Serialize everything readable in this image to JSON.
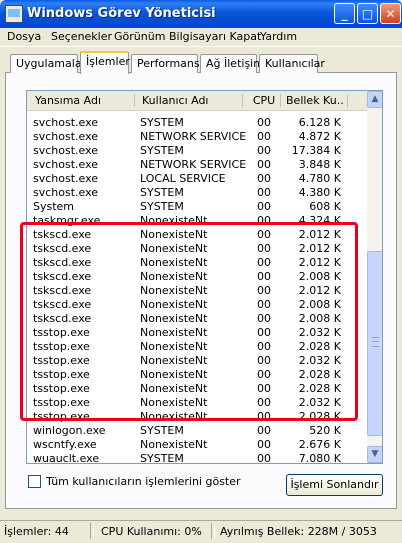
{
  "window": {
    "title": "Windows Görev Yöneticisi"
  },
  "menu": [
    "Dosya",
    "Seçenekler",
    "Görünüm",
    "Bilgisayarı Kapat",
    "Yardım"
  ],
  "tabs": [
    "Uygulamalar",
    "İşlemler",
    "Performans",
    "Ağ İletişimi",
    "Kullanıcılar"
  ],
  "active_tab": "İşlemler",
  "columns": [
    "Yansıma Adı",
    "Kullanıcı Adı",
    "CPU",
    "Bellek Ku..."
  ],
  "processes": [
    [
      "svchost.exe",
      "SYSTEM",
      "00",
      "6.128 K"
    ],
    [
      "svchost.exe",
      "NETWORK SERVICE",
      "00",
      "4.872 K"
    ],
    [
      "svchost.exe",
      "SYSTEM",
      "00",
      "17.384 K"
    ],
    [
      "svchost.exe",
      "NETWORK SERVICE",
      "00",
      "3.848 K"
    ],
    [
      "svchost.exe",
      "LOCAL SERVICE",
      "00",
      "4.780 K"
    ],
    [
      "svchost.exe",
      "SYSTEM",
      "00",
      "4.380 K"
    ],
    [
      "System",
      "SYSTEM",
      "00",
      "608 K"
    ],
    [
      "taskmgr.exe",
      "NonexisteNt",
      "00",
      "4.324 K"
    ],
    [
      "tskscd.exe",
      "NonexisteNt",
      "00",
      "2.012 K"
    ],
    [
      "tskscd.exe",
      "NonexisteNt",
      "00",
      "2.012 K"
    ],
    [
      "tskscd.exe",
      "NonexisteNt",
      "00",
      "2.012 K"
    ],
    [
      "tskscd.exe",
      "NonexisteNt",
      "00",
      "2.008 K"
    ],
    [
      "tskscd.exe",
      "NonexisteNt",
      "00",
      "2.012 K"
    ],
    [
      "tskscd.exe",
      "NonexisteNt",
      "00",
      "2.008 K"
    ],
    [
      "tskscd.exe",
      "NonexisteNt",
      "00",
      "2.008 K"
    ],
    [
      "tsstop.exe",
      "NonexisteNt",
      "00",
      "2.032 K"
    ],
    [
      "tsstop.exe",
      "NonexisteNt",
      "00",
      "2.028 K"
    ],
    [
      "tsstop.exe",
      "NonexisteNt",
      "00",
      "2.032 K"
    ],
    [
      "tsstop.exe",
      "NonexisteNt",
      "00",
      "2.028 K"
    ],
    [
      "tsstop.exe",
      "NonexisteNt",
      "00",
      "2.028 K"
    ],
    [
      "tsstop.exe",
      "NonexisteNt",
      "00",
      "2.032 K"
    ],
    [
      "tsstop.exe",
      "NonexisteNt",
      "00",
      "2.028 K"
    ],
    [
      "winlogon.exe",
      "SYSTEM",
      "00",
      "520 K"
    ],
    [
      "wscntfy.exe",
      "NonexisteNt",
      "00",
      "2.676 K"
    ],
    [
      "wuauclt.exe",
      "SYSTEM",
      "00",
      "7.080 K"
    ]
  ],
  "show_all_users_label": "Tüm kullanıcıların işlemlerini göster",
  "end_process_label": "İşlemi Sonlandır",
  "status": {
    "processes": "İşlemler: 44",
    "cpu": "CPU Kullanımı: 0%",
    "commit": "Ayrılmış Bellek: 228M / 3053"
  },
  "colors": {
    "annotation": "#e8001c",
    "titlebar": "#0a56d6"
  }
}
